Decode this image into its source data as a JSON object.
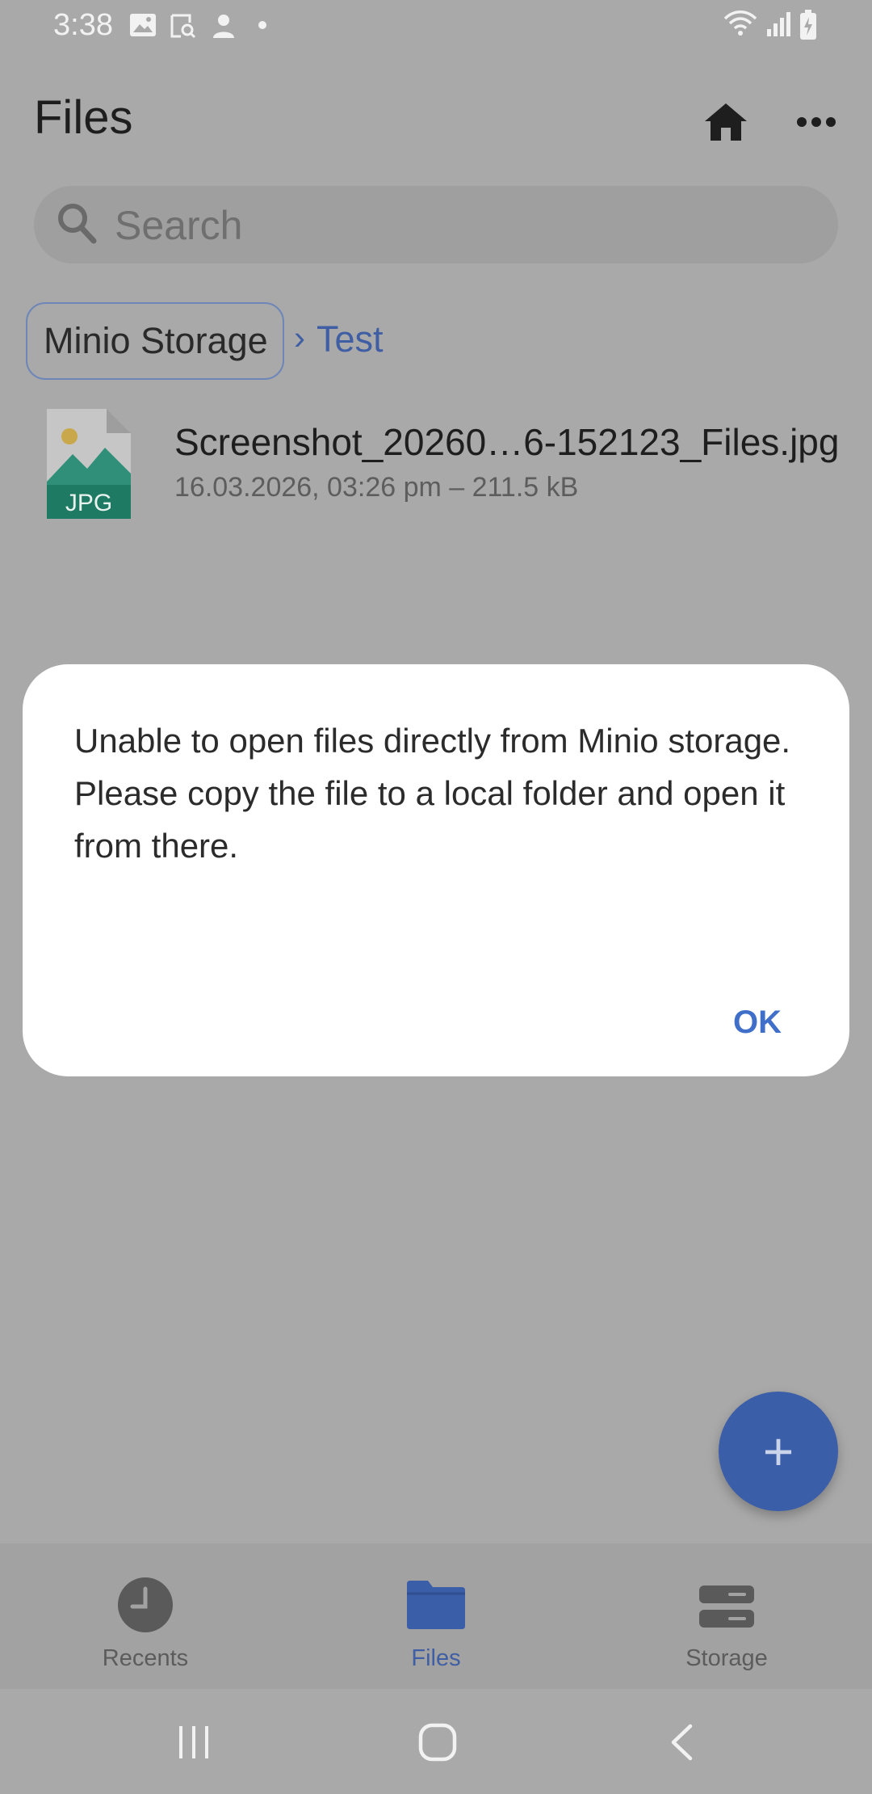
{
  "status_bar": {
    "time": "3:38",
    "left_icons": [
      "image-icon",
      "screenshot-icon",
      "person-icon",
      "dot-icon"
    ],
    "right_icons": [
      "wifi-icon",
      "signal-icon",
      "battery-charging-icon"
    ]
  },
  "app_bar": {
    "title": "Files",
    "actions": [
      "home-icon",
      "more-options-icon"
    ]
  },
  "search": {
    "placeholder": "Search"
  },
  "breadcrumb": {
    "root": "Minio Storage",
    "separator": "›",
    "current": "Test"
  },
  "files": [
    {
      "icon": "jpg-file-icon",
      "type_badge": "JPG",
      "name": "Screenshot_20260…6-152123_Files.jpg",
      "meta": "16.03.2026, 03:26 pm – 211.5 kB"
    }
  ],
  "dialog": {
    "message_line1": "Unable to open files directly from Minio storage.",
    "message_line2": "Please copy the file to a local folder and open it from there.",
    "ok_label": "OK"
  },
  "fab": {
    "label": "+"
  },
  "bottom_nav": {
    "items": [
      {
        "label": "Recents",
        "icon": "clock-icon",
        "active": false
      },
      {
        "label": "Files",
        "icon": "folder-icon",
        "active": true
      },
      {
        "label": "Storage",
        "icon": "storage-icon",
        "active": false
      }
    ]
  },
  "system_nav": [
    "recent-apps-icon",
    "home-circle-icon",
    "back-icon"
  ],
  "colors": {
    "scrim_background": "#a9a9a9",
    "accent": "#3f6fc8",
    "fab": "#3b5ea8",
    "dialog_background": "#ffffff"
  }
}
